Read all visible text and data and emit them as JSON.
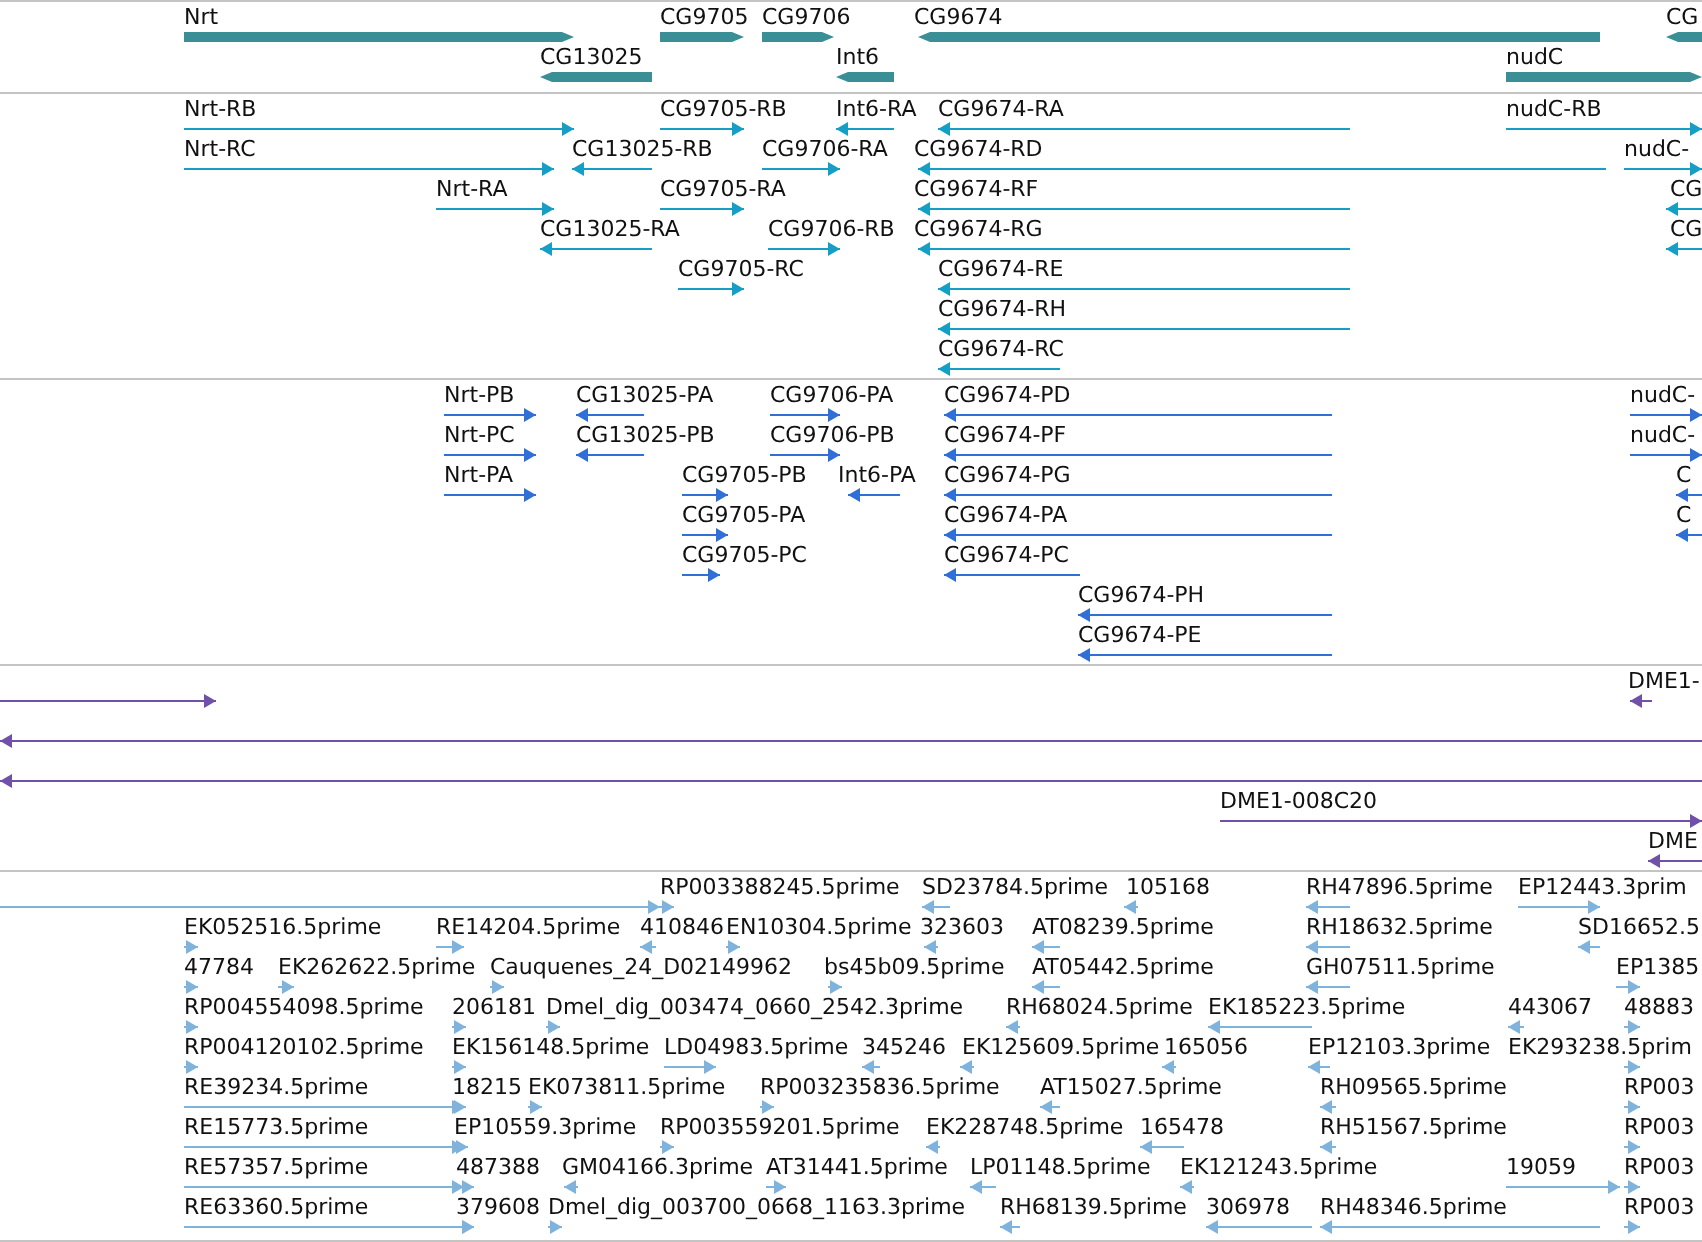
{
  "tracks": [
    {
      "kind": "genes",
      "color": "#3a8f96",
      "rows": [
        {
          "features": [
            {
              "label": "Nrt",
              "kind": "forward"
            },
            {
              "label": "CG9705",
              "kind": "forward"
            },
            {
              "label": "CG9706",
              "kind": "forward"
            },
            {
              "label": "CG9674",
              "kind": "reverse"
            },
            {
              "label": "CG",
              "kind": "reverse"
            }
          ]
        },
        {
          "features": [
            {
              "label": "CG13025",
              "kind": "reverse"
            },
            {
              "label": "Int6",
              "kind": "reverse"
            },
            {
              "label": "nudC",
              "kind": "forward"
            }
          ]
        }
      ]
    },
    {
      "kind": "transcripts",
      "color": "#159fc4",
      "rows": [
        {
          "features": [
            {
              "label": "Nrt-RB",
              "kind": "forward"
            },
            {
              "label": "CG9705-RB",
              "kind": "forward"
            },
            {
              "label": "Int6-RA",
              "kind": "reverse"
            },
            {
              "label": "CG9674-RA",
              "kind": "reverse"
            },
            {
              "label": "nudC-RB",
              "kind": "forward"
            }
          ]
        },
        {
          "features": [
            {
              "label": "Nrt-RC",
              "kind": "forward"
            },
            {
              "label": "CG13025-RB",
              "kind": "reverse"
            },
            {
              "label": "CG9706-RA",
              "kind": "forward"
            },
            {
              "label": "CG9674-RD",
              "kind": "reverse"
            },
            {
              "label": "nudC-",
              "kind": "forward"
            }
          ]
        },
        {
          "features": [
            {
              "label": "Nrt-RA",
              "kind": "forward"
            },
            {
              "label": "CG9705-RA",
              "kind": "forward"
            },
            {
              "label": "CG9674-RF",
              "kind": "reverse"
            },
            {
              "label": "CG",
              "kind": "reverse"
            }
          ]
        },
        {
          "features": [
            {
              "label": "CG13025-RA",
              "kind": "reverse"
            },
            {
              "label": "CG9706-RB",
              "kind": "forward"
            },
            {
              "label": "CG9674-RG",
              "kind": "reverse"
            },
            {
              "label": "CG",
              "kind": "reverse"
            }
          ]
        },
        {
          "features": [
            {
              "label": "CG9705-RC",
              "kind": "forward"
            },
            {
              "label": "CG9674-RE",
              "kind": "reverse"
            }
          ]
        },
        {
          "features": [
            {
              "label": "CG9674-RH",
              "kind": "reverse"
            }
          ]
        },
        {
          "features": [
            {
              "label": "CG9674-RC",
              "kind": "reverse"
            }
          ]
        }
      ]
    },
    {
      "kind": "proteins",
      "color": "#2f6fd6",
      "rows": [
        {
          "features": [
            {
              "label": "Nrt-PB",
              "kind": "forward"
            },
            {
              "label": "CG13025-PA",
              "kind": "reverse"
            },
            {
              "label": "CG9706-PA",
              "kind": "forward"
            },
            {
              "label": "CG9674-PD",
              "kind": "reverse"
            },
            {
              "label": "nudC-",
              "kind": "forward"
            }
          ]
        },
        {
          "features": [
            {
              "label": "Nrt-PC",
              "kind": "forward"
            },
            {
              "label": "CG13025-PB",
              "kind": "reverse"
            },
            {
              "label": "CG9706-PB",
              "kind": "forward"
            },
            {
              "label": "CG9674-PF",
              "kind": "reverse"
            },
            {
              "label": "nudC-",
              "kind": "forward"
            }
          ]
        },
        {
          "features": [
            {
              "label": "Nrt-PA",
              "kind": "forward"
            },
            {
              "label": "CG9705-PB",
              "kind": "forward"
            },
            {
              "label": "Int6-PA",
              "kind": "reverse"
            },
            {
              "label": "CG9674-PG",
              "kind": "reverse"
            },
            {
              "label": "C",
              "kind": "reverse"
            }
          ]
        },
        {
          "features": [
            {
              "label": "CG9705-PA",
              "kind": "forward"
            },
            {
              "label": "CG9674-PA",
              "kind": "reverse"
            },
            {
              "label": "C",
              "kind": "reverse"
            }
          ]
        },
        {
          "features": [
            {
              "label": "CG9705-PC",
              "kind": "forward"
            },
            {
              "label": "CG9674-PC",
              "kind": "reverse"
            }
          ]
        },
        {
          "features": [
            {
              "label": "CG9674-PH",
              "kind": "reverse"
            }
          ]
        },
        {
          "features": [
            {
              "label": "CG9674-PE",
              "kind": "reverse"
            }
          ]
        }
      ]
    },
    {
      "kind": "clones",
      "color": "#7050a8",
      "rows": [
        {
          "features": [
            {
              "kind": "forward"
            },
            {
              "label": "DME1-",
              "kind": "reverse"
            }
          ]
        },
        {
          "features": [
            {
              "kind": "reverse"
            }
          ]
        },
        {
          "features": [
            {
              "kind": "reverse"
            }
          ]
        },
        {
          "features": [
            {
              "label": "DME1-008C20",
              "kind": "forward"
            }
          ]
        },
        {
          "features": [
            {
              "label": "DME",
              "kind": "reverse"
            }
          ]
        }
      ]
    },
    {
      "kind": "ests",
      "color": "#7fb3dc",
      "rows": [
        {
          "features": [
            {
              "kind": "forward"
            },
            {
              "label": "RP003388245.5prime",
              "kind": "forward"
            },
            {
              "label": "SD23784.5prime",
              "kind": "reverse"
            },
            {
              "label": "105168",
              "kind": "reverse"
            },
            {
              "label": "RH47896.5prime",
              "kind": "reverse"
            },
            {
              "label": "EP12443.3prim",
              "kind": "forward"
            }
          ]
        },
        {
          "features": [
            {
              "label": "EK052516.5prime",
              "kind": "forward"
            },
            {
              "label": "RE14204.5prime",
              "kind": "forward"
            },
            {
              "label": "410846",
              "kind": "reverse"
            },
            {
              "label": "EN10304.5prime",
              "kind": "forward"
            },
            {
              "label": "323603",
              "kind": "reverse"
            },
            {
              "label": "AT08239.5prime",
              "kind": "reverse"
            },
            {
              "label": "RH18632.5prime",
              "kind": "reverse"
            },
            {
              "label": "SD16652.5",
              "kind": "reverse"
            }
          ]
        },
        {
          "features": [
            {
              "label": "47784",
              "kind": "forward"
            },
            {
              "label": "EK262622.5prime",
              "kind": "forward"
            },
            {
              "label": "Cauquenes_24_D02149962",
              "kind": "forward"
            },
            {
              "label": "bs45b09.5prime",
              "kind": "forward"
            },
            {
              "label": "AT05442.5prime",
              "kind": "reverse"
            },
            {
              "label": "GH07511.5prime",
              "kind": "reverse"
            },
            {
              "label": "EP1385",
              "kind": "forward"
            }
          ]
        },
        {
          "features": [
            {
              "label": "RP004554098.5prime",
              "kind": "forward"
            },
            {
              "label": "206181",
              "kind": "forward"
            },
            {
              "label": "Dmel_dig_003474_0660_2542.3prime",
              "kind": "forward"
            },
            {
              "label": "RH68024.5prime",
              "kind": "reverse"
            },
            {
              "label": "EK185223.5prime",
              "kind": "reverse"
            },
            {
              "label": "443067",
              "kind": "reverse"
            },
            {
              "label": "48883",
              "kind": "forward"
            }
          ]
        },
        {
          "features": [
            {
              "label": "RP004120102.5prime",
              "kind": "forward"
            },
            {
              "label": "EK156148.5prime",
              "kind": "forward"
            },
            {
              "label": "LD04983.5prime",
              "kind": "forward"
            },
            {
              "label": "345246",
              "kind": "reverse"
            },
            {
              "label": "EK125609.5prime",
              "kind": "reverse"
            },
            {
              "label": "165056",
              "kind": "reverse"
            },
            {
              "label": "EP12103.3prime",
              "kind": "reverse"
            },
            {
              "label": "EK293238.5prim",
              "kind": "forward"
            }
          ]
        },
        {
          "features": [
            {
              "label": "RE39234.5prime",
              "kind": "forward"
            },
            {
              "label": "18215",
              "kind": "forward"
            },
            {
              "label": "EK073811.5prime",
              "kind": "forward"
            },
            {
              "label": "RP003235836.5prime",
              "kind": "forward"
            },
            {
              "label": "AT15027.5prime",
              "kind": "reverse"
            },
            {
              "label": "RH09565.5prime",
              "kind": "reverse"
            },
            {
              "label": "RP003",
              "kind": "forward"
            }
          ]
        },
        {
          "features": [
            {
              "label": "RE15773.5prime",
              "kind": "forward"
            },
            {
              "label": "EP10559.3prime",
              "kind": "forward"
            },
            {
              "label": "RP003559201.5prime",
              "kind": "forward"
            },
            {
              "label": "EK228748.5prime",
              "kind": "reverse"
            },
            {
              "label": "165478",
              "kind": "reverse"
            },
            {
              "label": "RH51567.5prime",
              "kind": "reverse"
            },
            {
              "label": "RP003",
              "kind": "forward"
            }
          ]
        },
        {
          "features": [
            {
              "label": "RE57357.5prime",
              "kind": "forward"
            },
            {
              "label": "487388",
              "kind": "forward"
            },
            {
              "label": "GM04166.3prime",
              "kind": "reverse"
            },
            {
              "label": "AT31441.5prime",
              "kind": "forward"
            },
            {
              "label": "LP01148.5prime",
              "kind": "reverse"
            },
            {
              "label": "EK121243.5prime",
              "kind": "reverse"
            },
            {
              "label": "19059",
              "kind": "forward"
            },
            {
              "label": "RP003",
              "kind": "forward"
            }
          ]
        },
        {
          "features": [
            {
              "label": "RE63360.5prime",
              "kind": "forward"
            },
            {
              "label": "379608",
              "kind": "forward"
            },
            {
              "label": "Dmel_dig_003700_0668_1163.3prime",
              "kind": "forward"
            },
            {
              "label": "RH68139.5prime",
              "kind": "reverse"
            },
            {
              "label": "306978",
              "kind": "reverse"
            },
            {
              "label": "RH48346.5prime",
              "kind": "reverse"
            },
            {
              "label": "RP003",
              "kind": "forward"
            }
          ]
        }
      ]
    }
  ]
}
